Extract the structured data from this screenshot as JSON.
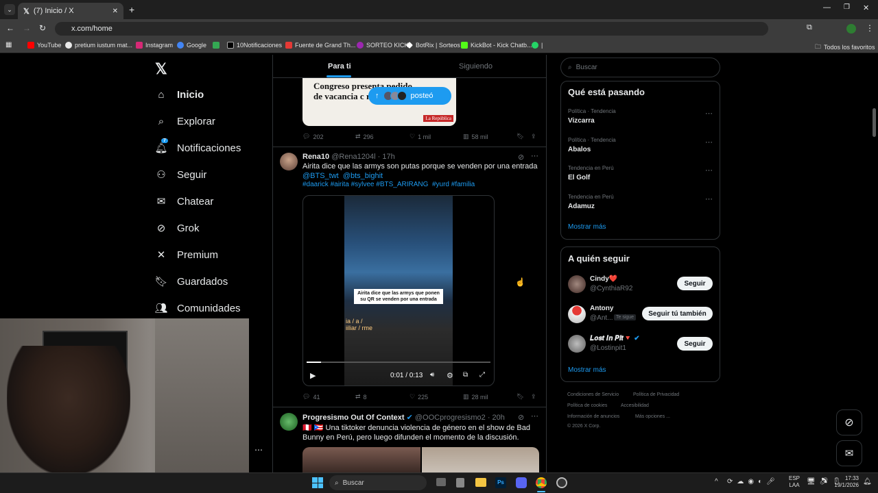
{
  "browser": {
    "tab_title": "(7) Inicio / X",
    "url": "x.com/home",
    "bookmarks": [
      {
        "label": "YouTube",
        "color": "#ff0000"
      },
      {
        "label": "pretium iustum mat...",
        "color": "#e8e8e8"
      },
      {
        "label": "Instagram",
        "color": "#d62976"
      },
      {
        "label": "Google",
        "color": "#4285f4"
      },
      {
        "label": "",
        "color": "#34a853"
      },
      {
        "label": "10Notificaciones",
        "color": "#000000"
      },
      {
        "label": "Fuente de Grand Th...",
        "color": "#e53935"
      },
      {
        "label": "SORTEO KICK",
        "color": "#9c27b0"
      },
      {
        "label": "BotRix | Sorteos",
        "color": "#ffffff"
      },
      {
        "label": "KickBot - Kick Chatb...",
        "color": "#53fc18"
      },
      {
        "label": "|",
        "color": "#25d366"
      }
    ],
    "all_bookmarks": "Todos los favoritos"
  },
  "nav": {
    "items": [
      {
        "label": "Inicio",
        "icon": "home-icon"
      },
      {
        "label": "Explorar",
        "icon": "search-icon"
      },
      {
        "label": "Notificaciones",
        "icon": "bell-icon",
        "badge": "7"
      },
      {
        "label": "Seguir",
        "icon": "person-add-icon"
      },
      {
        "label": "Chatear",
        "icon": "mail-icon"
      },
      {
        "label": "Grok",
        "icon": "grok-icon"
      },
      {
        "label": "Premium",
        "icon": "x-icon"
      },
      {
        "label": "Guardados",
        "icon": "bookmark-icon"
      },
      {
        "label": "Comunidades",
        "icon": "people-icon"
      }
    ]
  },
  "feed": {
    "tabs": {
      "for_you": "Para ti",
      "following": "Siguiendo"
    },
    "posted_pill": "posteó",
    "post1": {
      "image_text": "Congreso presenta pedido de vacancia c reunión con",
      "source": "La República",
      "replies": "202",
      "reposts": "296",
      "likes": "1 mil",
      "views": "58 mil"
    },
    "post2": {
      "name": "Rena10",
      "handle": "@Rena1204l",
      "time": "· 17h",
      "text": "Airita dice que las armys  son putas porque se venden por una entrada",
      "mentions": "@BTS_twt  @bts_bighit",
      "hashtags": "#daarick #airita #sylvee #BTS_ARIRANG  #yurd #familia",
      "video_caption": "Airita dice que las armys que ponen su QR se venden por una entrada",
      "video_overlay_left": "ia / a / iiliar / rme",
      "time_code": "0:01 / 0:13",
      "replies": "41",
      "reposts": "8",
      "likes": "225",
      "views": "28 mil"
    },
    "post3": {
      "name": "Progresismo Out Of Context",
      "handle": "@OOCprogresismo2",
      "time": "· 20h",
      "text": "Una tiktoker denuncia violencia de género en el show de Bad Bunny en Perú, pero luego difunden el momento de la discusión."
    }
  },
  "right": {
    "search_placeholder": "Buscar",
    "trends_title": "Qué está pasando",
    "trends": [
      {
        "meta": "Política · Tendencia",
        "name": "Vizcarra"
      },
      {
        "meta": "Política · Tendencia",
        "name": "Abalos"
      },
      {
        "meta": "Tendencia en Perú",
        "name": "El Golf"
      },
      {
        "meta": "Tendencia en Perú",
        "name": "Adamuz"
      }
    ],
    "show_more": "Mostrar más",
    "who_title": "A quién seguir",
    "who": [
      {
        "name": "Cindy❤️",
        "handle": "@CynthiaR92",
        "button": "Seguir"
      },
      {
        "name": "Antony",
        "handle": "@Ant...",
        "follows_you": "Te sigue",
        "button": "Seguir tú también"
      },
      {
        "name": "𝑳𝒐𝒔𝒕 𝑰𝒏 𝑷𝒊𝒕🔻",
        "handle": "@Lostinpit1",
        "button": "Seguir"
      }
    ],
    "show_more2": "Mostrar más",
    "footer": {
      "l1a": "Condiciones de Servicio",
      "l1b": "Política de Privacidad",
      "l2a": "Política de cookies",
      "l2b": "Accesibilidad",
      "l3a": "Información de anuncios",
      "l3b": "Más opciones ...",
      "copyright": "© 2026 X Corp."
    }
  },
  "taskbar": {
    "search": "Buscar",
    "lang1": "ESP",
    "lang2": "LAA",
    "time": "17:33",
    "date": "19/1/2026"
  }
}
